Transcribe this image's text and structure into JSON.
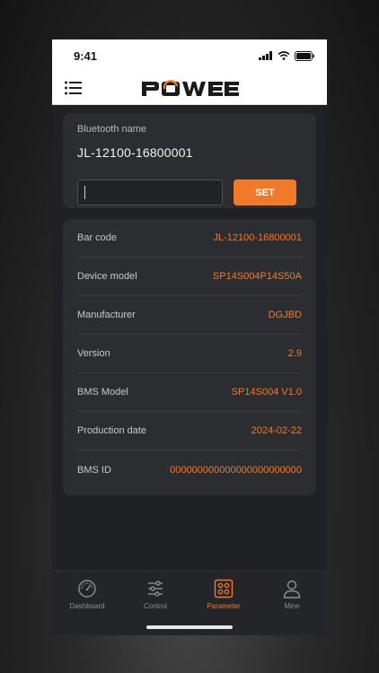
{
  "status_bar": {
    "time": "9:41"
  },
  "header": {
    "logo_text": "POWEE"
  },
  "bluetooth": {
    "label": "Bluetooth name",
    "name": "JL-12100-16800001",
    "input_value": "",
    "set_label": "SET"
  },
  "device_info": {
    "rows": [
      {
        "label": "Bar code",
        "value": "JL-12100-16800001"
      },
      {
        "label": "Device model",
        "value": "SP14S004P14S50A"
      },
      {
        "label": "Manufacturer",
        "value": "DGJBD"
      },
      {
        "label": "Version",
        "value": "2.9"
      },
      {
        "label": "BMS Model",
        "value": "SP14S004 V1.0"
      },
      {
        "label": "Production date",
        "value": "2024-02-22"
      },
      {
        "label": "BMS ID",
        "value": "000000000000000000000000"
      }
    ]
  },
  "tabs": [
    {
      "label": "Dashboard",
      "icon": "gauge-icon",
      "active": false
    },
    {
      "label": "Control",
      "icon": "sliders-icon",
      "active": false
    },
    {
      "label": "Parameter",
      "icon": "parameter-icon",
      "active": true
    },
    {
      "label": "Mine",
      "icon": "user-icon",
      "active": false
    }
  ],
  "colors": {
    "accent": "#f07a2a",
    "card": "#2b2d31",
    "background": "#1f2124"
  }
}
